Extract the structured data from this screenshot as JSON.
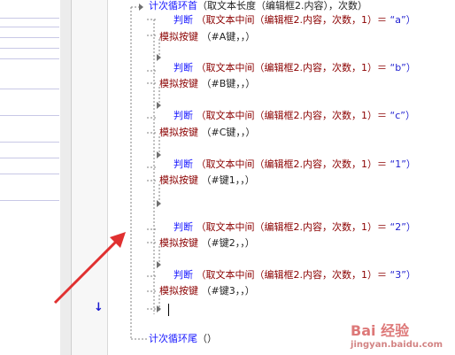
{
  "code": {
    "loop_header": {
      "kw": "计次循环首",
      "arg": "（取文本长度（编辑框2.内容），次数）"
    },
    "blocks": [
      {
        "judge": "判断",
        "fn": "（取文本中间（编辑框2.内容，次数，1）＝",
        "str": "“a”）",
        "sim": "模拟按键",
        "key": "（#A键，，）"
      },
      {
        "judge": "判断",
        "fn": "（取文本中间（编辑框2.内容，次数，1）＝",
        "str": "“b”）",
        "sim": "模拟按键",
        "key": "（#B键，，）"
      },
      {
        "judge": "判断",
        "fn": "（取文本中间（编辑框2.内容，次数，1）＝",
        "str": "“c”）",
        "sim": "模拟按键",
        "key": "（#C键，，）"
      },
      {
        "judge": "判断",
        "fn": "（取文本中间（编辑框2.内容，次数，1）＝",
        "str": "“1”）",
        "sim": "模拟按键",
        "key": "（#键1，，）"
      },
      {
        "judge": "判断",
        "fn": "（取文本中间（编辑框2.内容，次数，1）＝",
        "str": "“2”）",
        "sim": "模拟按键",
        "key": "（#键2，，）"
      },
      {
        "judge": "判断",
        "fn": "（取文本中间（编辑框2.内容，次数，1）＝",
        "str": "“3”）",
        "sim": "模拟按键",
        "key": "（#键3，，）"
      }
    ],
    "loop_footer": {
      "kw": "计次循环尾",
      "arg": "（）"
    }
  },
  "watermark": {
    "logo": "Bai 经验",
    "url": "jingyan.baidu.com"
  },
  "colors": {
    "keyword": "#1a1aff",
    "command": "#8b0000",
    "annotation_arrow": "#e03030"
  }
}
